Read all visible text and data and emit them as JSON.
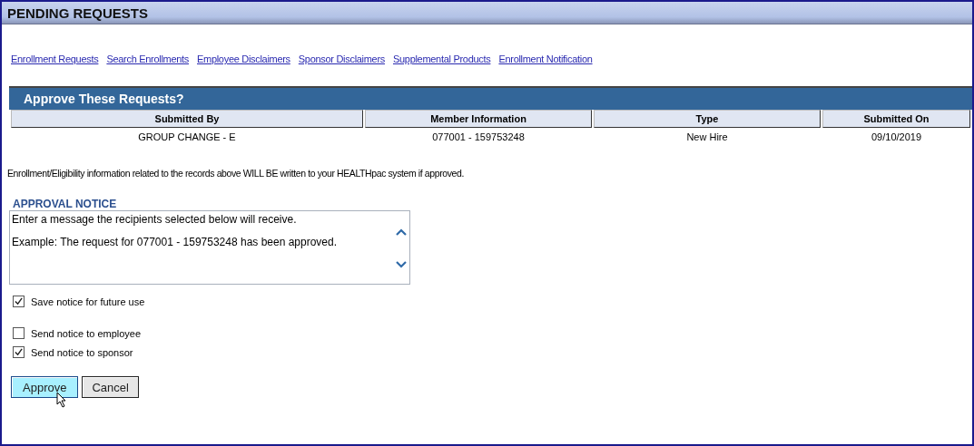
{
  "page_title": "PENDING REQUESTS",
  "links": [
    "Enrollment Requests",
    "Search Enrollments",
    "Employee Disclaimers",
    "Sponsor Disclaimers",
    "Supplemental Products",
    "Enrollment Notification"
  ],
  "section_title": "Approve These Requests?",
  "table": {
    "columns": [
      "Submitted By",
      "Member Information",
      "Type",
      "Submitted On"
    ],
    "rows": [
      [
        "GROUP CHANGE - E",
        "077001 - 159753248",
        "New Hire",
        "09/10/2019"
      ]
    ]
  },
  "info_text": "Enrollment/Eligibility information related to the records above WILL BE written to your HEALTHpac system if approved.",
  "notice": {
    "label": "APPROVAL NOTICE",
    "lines": [
      "Enter a message the recipients selected below will receive.",
      "Example: The request for 077001 - 159753248 has been approved."
    ]
  },
  "options": [
    {
      "label": "Save notice for future use",
      "checked": true
    },
    {
      "label": "Send notice to employee",
      "checked": false
    },
    {
      "label": "Send notice to sponsor",
      "checked": true
    }
  ],
  "buttons": [
    {
      "label": "Approve",
      "hovered": true
    },
    {
      "label": "Cancel",
      "hovered": false
    }
  ]
}
